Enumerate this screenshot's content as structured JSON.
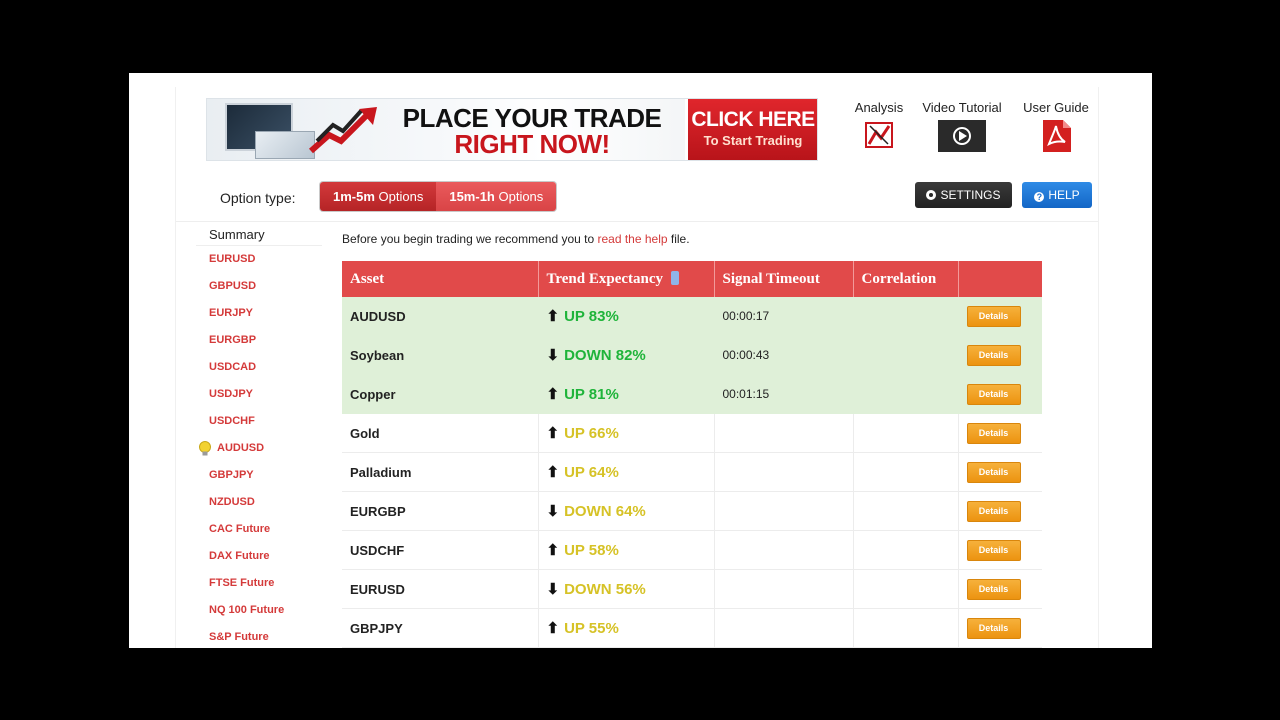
{
  "banner": {
    "line1": "PLACE YOUR TRADE",
    "line2": "RIGHT NOW!",
    "cta_line1": "CLICK HERE",
    "cta_line2": "To Start Trading"
  },
  "top_links": {
    "analysis": "Analysis",
    "video": "Video Tutorial",
    "guide": "User Guide"
  },
  "option_type": {
    "label": "Option type:",
    "options": [
      {
        "bold": "1m-5m",
        "rest": " Options"
      },
      {
        "bold": "15m-1h",
        "rest": " Options"
      }
    ]
  },
  "buttons": {
    "settings": "SETTINGS",
    "help": "HELP"
  },
  "sidebar": {
    "summary": "Summary",
    "items": [
      "EURUSD",
      "GBPUSD",
      "EURJPY",
      "EURGBP",
      "USDCAD",
      "USDJPY",
      "USDCHF",
      "AUDUSD",
      "GBPJPY",
      "NZDUSD",
      "CAC Future",
      "DAX Future",
      "FTSE Future",
      "NQ 100 Future",
      "S&P Future"
    ]
  },
  "intro": {
    "before": "Before you begin trading we recommend you to ",
    "link": "read the help",
    "after": " file."
  },
  "table": {
    "headers": [
      "Asset",
      "Trend Expectancy",
      "Signal Timeout",
      "Correlation",
      ""
    ],
    "details_label": "Details",
    "rows": [
      {
        "asset": "AUDUSD",
        "dir": "up",
        "trend": "UP 83%",
        "timeout": "00:00:17",
        "correlation": "",
        "highlight": true
      },
      {
        "asset": "Soybean",
        "dir": "down",
        "trend": "DOWN 82%",
        "timeout": "00:00:43",
        "correlation": "",
        "highlight": true
      },
      {
        "asset": "Copper",
        "dir": "up",
        "trend": "UP 81%",
        "timeout": "00:01:15",
        "correlation": "",
        "highlight": true
      },
      {
        "asset": "Gold",
        "dir": "up",
        "trend": "UP 66%",
        "timeout": "",
        "correlation": "",
        "highlight": false
      },
      {
        "asset": "Palladium",
        "dir": "up",
        "trend": "UP 64%",
        "timeout": "",
        "correlation": "",
        "highlight": false
      },
      {
        "asset": "EURGBP",
        "dir": "down",
        "trend": "DOWN 64%",
        "timeout": "",
        "correlation": "",
        "highlight": false
      },
      {
        "asset": "USDCHF",
        "dir": "up",
        "trend": "UP 58%",
        "timeout": "",
        "correlation": "",
        "highlight": false
      },
      {
        "asset": "EURUSD",
        "dir": "down",
        "trend": "DOWN 56%",
        "timeout": "",
        "correlation": "",
        "highlight": false
      },
      {
        "asset": "GBPJPY",
        "dir": "up",
        "trend": "UP 55%",
        "timeout": "",
        "correlation": "",
        "highlight": false
      }
    ]
  },
  "colors": {
    "accent_red": "#e14a4a",
    "trend_strong": "#1fb43a",
    "trend_weak": "#d6c226",
    "highlight_row": "#dff0d8",
    "details_orange": "#f0a021"
  },
  "icons": {
    "analysis": "chart-analysis-icon",
    "video": "play-video-icon",
    "guide": "pdf-icon",
    "settings": "gear-icon",
    "help": "question-icon",
    "active_asset": "lightbulb-icon",
    "sort": "sort-icon"
  }
}
